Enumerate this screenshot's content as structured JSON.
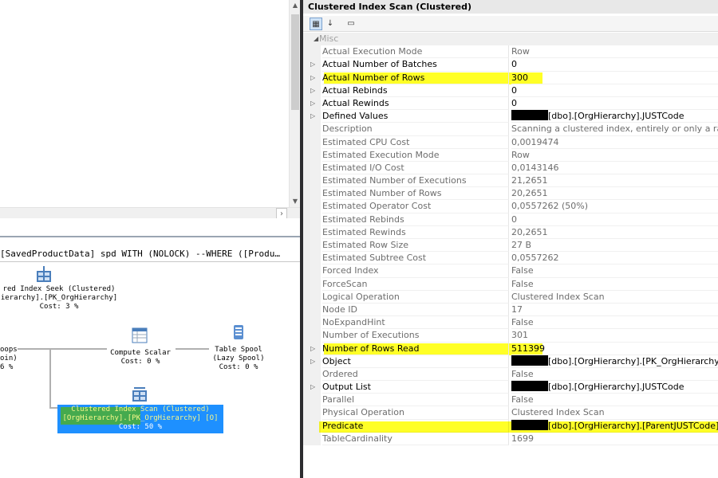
{
  "plan": {
    "query_text": "[SavedProductData] spd WITH (NOLOCK) --WHERE ([Produ…",
    "operators": {
      "index_seek": {
        "line1": "red Index Seek (Clustered)",
        "line2": "ierarchy].[PK_OrgHierarchy]",
        "cost": "Cost: 3 %"
      },
      "nested_loops": {
        "line1": "oops",
        "line2": "oin)",
        "cost": "6 %"
      },
      "compute_scalar": {
        "line1": "Compute Scalar",
        "cost": "Cost: 0 %"
      },
      "table_spool": {
        "line1": "Table Spool",
        "line2": "(Lazy Spool)",
        "cost": "Cost: 0 %"
      },
      "clustered_scan": {
        "line1": "Clustered Index Scan (Clustered)",
        "line2": "[OrgHierarchy].[PK_OrgHierarchy] [O]",
        "cost": "Cost: 50 %"
      }
    }
  },
  "properties": {
    "title": "Clustered Index Scan (Clustered)",
    "category": "Misc",
    "rows": [
      {
        "name": "Actual Execution Mode",
        "value": "Row",
        "expandable": false,
        "grey": true
      },
      {
        "name": "Actual Number of Batches",
        "value": "0",
        "expandable": true,
        "grey": false
      },
      {
        "name": "Actual Number of Rows",
        "value": "300",
        "expandable": true,
        "grey": false,
        "highlight": true
      },
      {
        "name": "Actual Rebinds",
        "value": "0",
        "expandable": true,
        "grey": false
      },
      {
        "name": "Actual Rewinds",
        "value": "0",
        "expandable": true,
        "grey": false
      },
      {
        "name": "Defined Values",
        "value": "[dbo].[OrgHierarchy].JUSTCode",
        "expandable": true,
        "grey": false,
        "redacted": true
      },
      {
        "name": "Description",
        "value": "Scanning a clustered index, entirely or only a range.",
        "expandable": false,
        "grey": true
      },
      {
        "name": "Estimated CPU Cost",
        "value": "0,0019474",
        "expandable": false,
        "grey": true
      },
      {
        "name": "Estimated Execution Mode",
        "value": "Row",
        "expandable": false,
        "grey": true
      },
      {
        "name": "Estimated I/O Cost",
        "value": "0,0143146",
        "expandable": false,
        "grey": true
      },
      {
        "name": "Estimated Number of Executions",
        "value": "21,2651",
        "expandable": false,
        "grey": true
      },
      {
        "name": "Estimated Number of Rows",
        "value": "20,2651",
        "expandable": false,
        "grey": true
      },
      {
        "name": "Estimated Operator Cost",
        "value": "0,0557262 (50%)",
        "expandable": false,
        "grey": true
      },
      {
        "name": "Estimated Rebinds",
        "value": "0",
        "expandable": false,
        "grey": true
      },
      {
        "name": "Estimated Rewinds",
        "value": "20,2651",
        "expandable": false,
        "grey": true
      },
      {
        "name": "Estimated Row Size",
        "value": "27 B",
        "expandable": false,
        "grey": true
      },
      {
        "name": "Estimated Subtree Cost",
        "value": "0,0557262",
        "expandable": false,
        "grey": true
      },
      {
        "name": "Forced Index",
        "value": "False",
        "expandable": false,
        "grey": true
      },
      {
        "name": "ForceScan",
        "value": "False",
        "expandable": false,
        "grey": true
      },
      {
        "name": "Logical Operation",
        "value": "Clustered Index Scan",
        "expandable": false,
        "grey": true
      },
      {
        "name": "Node ID",
        "value": "17",
        "expandable": false,
        "grey": true
      },
      {
        "name": "NoExpandHint",
        "value": "False",
        "expandable": false,
        "grey": true
      },
      {
        "name": "Number of Executions",
        "value": "301",
        "expandable": false,
        "grey": true
      },
      {
        "name": "Number of Rows Read",
        "value": "511399",
        "expandable": true,
        "grey": false,
        "highlight": true
      },
      {
        "name": "Object",
        "value": "[dbo].[OrgHierarchy].[PK_OrgHierarchy] [O]",
        "expandable": true,
        "grey": false,
        "redacted": true
      },
      {
        "name": "Ordered",
        "value": "False",
        "expandable": false,
        "grey": true
      },
      {
        "name": "Output List",
        "value": "[dbo].[OrgHierarchy].JUSTCode",
        "expandable": true,
        "grey": false,
        "redacted": true
      },
      {
        "name": "Parallel",
        "value": "False",
        "expandable": false,
        "grey": true
      },
      {
        "name": "Physical Operation",
        "value": "Clustered Index Scan",
        "expandable": false,
        "grey": true
      },
      {
        "name": "Predicate",
        "value": "[dbo].[OrgHierarchy].[ParentJUSTCode] as [O].[",
        "expandable": false,
        "grey": false,
        "redacted": true,
        "highlight_wide": true
      },
      {
        "name": "TableCardinality",
        "value": "1699",
        "expandable": false,
        "grey": true
      }
    ]
  },
  "colors": {
    "selection": "#1e90ff",
    "highlight": "#ffff00",
    "selected_text": "#f8f88a"
  }
}
